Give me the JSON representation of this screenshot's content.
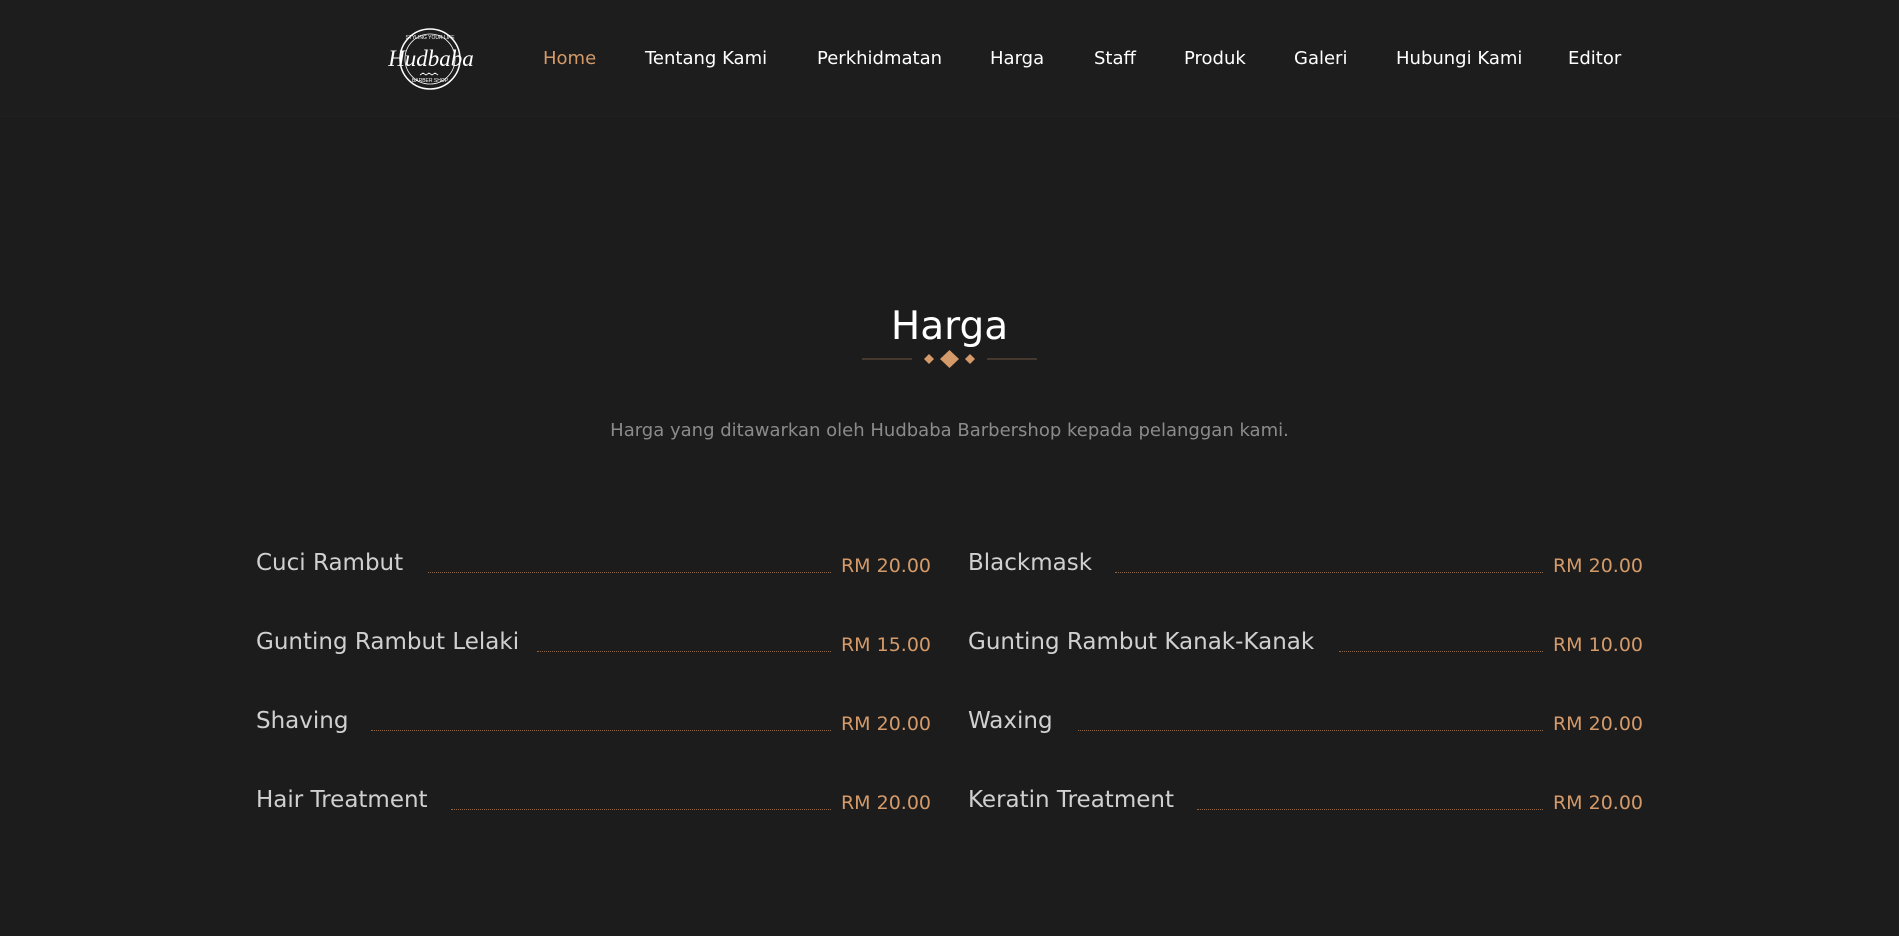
{
  "brand": {
    "logo_text": "Hudbaba",
    "logo_top_text": "STYLING YOUR LIFE",
    "logo_bottom_text": "BARBER SHOP"
  },
  "nav": {
    "items": [
      {
        "label": "Home",
        "active": true
      },
      {
        "label": "Tentang Kami",
        "active": false
      },
      {
        "label": "Perkhidmatan",
        "active": false
      },
      {
        "label": "Harga",
        "active": false
      },
      {
        "label": "Staff",
        "active": false
      },
      {
        "label": "Produk",
        "active": false
      },
      {
        "label": "Galeri",
        "active": false
      },
      {
        "label": "Hubungi Kami",
        "active": false
      },
      {
        "label": "Editor",
        "active": false
      }
    ]
  },
  "section": {
    "title": "Harga",
    "subtitle": "Harga yang ditawarkan oleh Hudbaba Barbershop kepada pelanggan kami."
  },
  "prices": [
    {
      "name": "Cuci Rambut",
      "price": "RM 20.00"
    },
    {
      "name": "Blackmask",
      "price": "RM 20.00"
    },
    {
      "name": "Gunting Rambut Lelaki",
      "price": "RM 15.00"
    },
    {
      "name": "Gunting Rambut Kanak-Kanak",
      "price": "RM 10.00"
    },
    {
      "name": "Shaving",
      "price": "RM 20.00"
    },
    {
      "name": "Waxing",
      "price": "RM 20.00"
    },
    {
      "name": "Hair Treatment",
      "price": "RM 20.00"
    },
    {
      "name": "Keratin Treatment",
      "price": "RM 20.00"
    }
  ],
  "colors": {
    "accent": "#d49a69",
    "background": "#1c1c1c",
    "text": "#ffffff",
    "muted": "#8b8b8b"
  }
}
